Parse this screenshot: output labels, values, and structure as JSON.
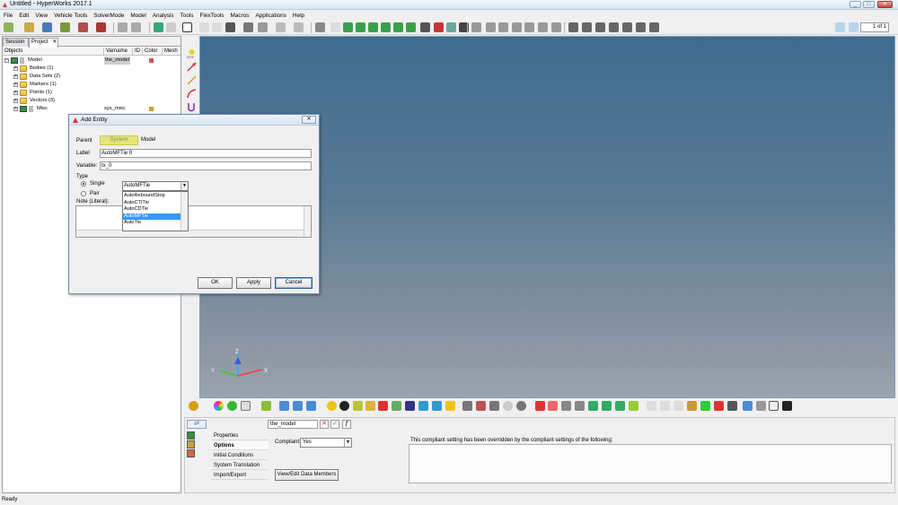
{
  "window": {
    "title": "Untitled - HyperWorks 2017.1",
    "min_label": "_",
    "max_label": "□",
    "close_label": "✕"
  },
  "menu": [
    "File",
    "Edit",
    "View",
    "Vehicle Tools",
    "SolverMode",
    "Model",
    "Analysis",
    "Tools",
    "FlexTools",
    "Macros",
    "Applications",
    "Help"
  ],
  "toolbar": {
    "page_indicator": "1 of 1"
  },
  "browser": {
    "tabs": [
      "Session",
      "Project"
    ],
    "tab_close": "✕",
    "columns": [
      "Objects",
      "Varname",
      "ID",
      "Color",
      "Mesh"
    ],
    "rows": [
      {
        "label": "Model",
        "varname": "the_model",
        "color": "#e05050"
      },
      {
        "label": "Bodies (1)"
      },
      {
        "label": "Data Sets (2)"
      },
      {
        "label": "Markers (1)"
      },
      {
        "label": "Points (1)"
      },
      {
        "label": "Vectors (3)"
      },
      {
        "label": "Misc",
        "varname": "sys_misc",
        "color": "#c9a233"
      }
    ]
  },
  "panel": {
    "entity_value": "the_model",
    "menu_items": [
      "Properties",
      "Options",
      "Initial Conditions",
      "System Translation",
      "Import/Export"
    ],
    "compliant_label": "Compliant:",
    "compliant_value": "Yes",
    "view_edit_label": "View/Edit Data Members",
    "override_text": "This compliant setting has been overridden by the compliant settings of the following:"
  },
  "status": {
    "text": "Ready"
  },
  "dialog": {
    "title": "Add Entity",
    "close_label": "✕",
    "parent_label": "Parent",
    "parent_button": "System",
    "parent_value": "Model",
    "label_label": "Label",
    "label_value": "AutoMFTie 0",
    "variable_label": "Variable:",
    "variable_value": "tx_0",
    "type_label": "Type",
    "single_label": "Single",
    "pair_label": "Pair",
    "note_label": "Note (Literal):",
    "type_selected": "AutoMFTie",
    "type_options": [
      "AutoReboundStop",
      "AutoCTITie",
      "AutoCDTie",
      "AutoMFTie",
      "AutoTie"
    ],
    "ok_label": "OK",
    "apply_label": "Apply",
    "cancel_label": "Cancel"
  },
  "viewport": {
    "axis_x": "X",
    "axis_y": "Y",
    "axis_z": "Z"
  }
}
